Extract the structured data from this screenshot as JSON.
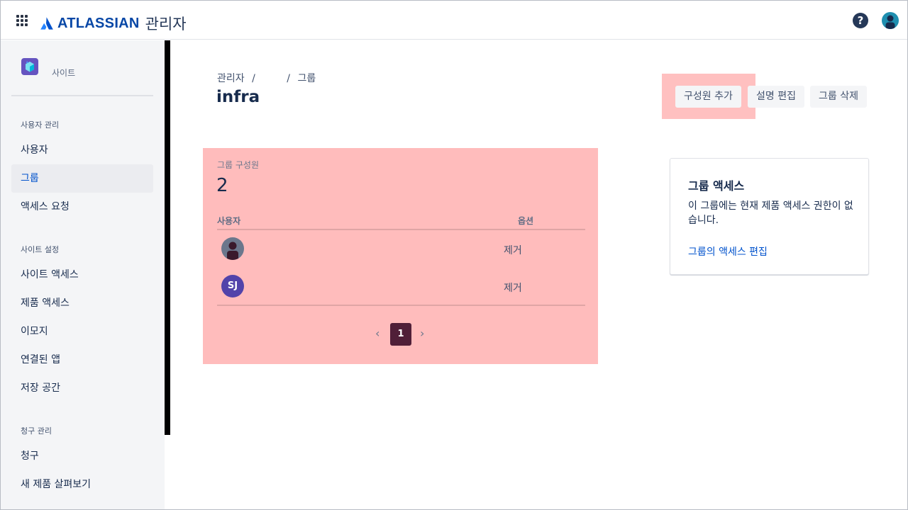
{
  "header": {
    "brand": "ATLASSIAN",
    "product": "관리자",
    "help_label": "?"
  },
  "sidebar": {
    "site_label": "사이트",
    "sections": [
      {
        "title": "사용자 관리",
        "items": [
          "사용자",
          "그룹",
          "액세스 요청"
        ]
      },
      {
        "title": "사이트 설정",
        "items": [
          "사이트 액세스",
          "제품 액세스",
          "이모지",
          "연결된 앱",
          "저장 공간"
        ]
      },
      {
        "title": "청구 관리",
        "items": [
          "청구",
          "새 제품 살펴보기"
        ]
      }
    ],
    "active_item": "그룹"
  },
  "breadcrumb": [
    "관리자",
    "/",
    "/",
    "그룹"
  ],
  "page_title": "infra",
  "actions": {
    "add_member": "구성원 추가",
    "edit_description": "설명 편집",
    "delete_group": "그룹 삭제"
  },
  "members": {
    "label": "그룹 구성원",
    "count": "2",
    "columns": [
      "사용자",
      "옵션"
    ],
    "rows": [
      {
        "avatar": "user-silhouette",
        "initials": "",
        "action": "제거"
      },
      {
        "avatar": "initials",
        "initials": "SJ",
        "action": "제거"
      }
    ],
    "pagination": {
      "prev": "‹",
      "current": "1",
      "next": "›"
    }
  },
  "group_access": {
    "title": "그룹 액세스",
    "description": "이 그룹에는 현재 제품 액세스 권한이 없습니다.",
    "link": "그룹의 액세스 편집"
  },
  "colors": {
    "brand_blue": "#0747a6",
    "link_blue": "#0052cc",
    "highlight": "#ffbcbc",
    "page_current": "#501f38",
    "initials_avatar": "#5243aa"
  }
}
